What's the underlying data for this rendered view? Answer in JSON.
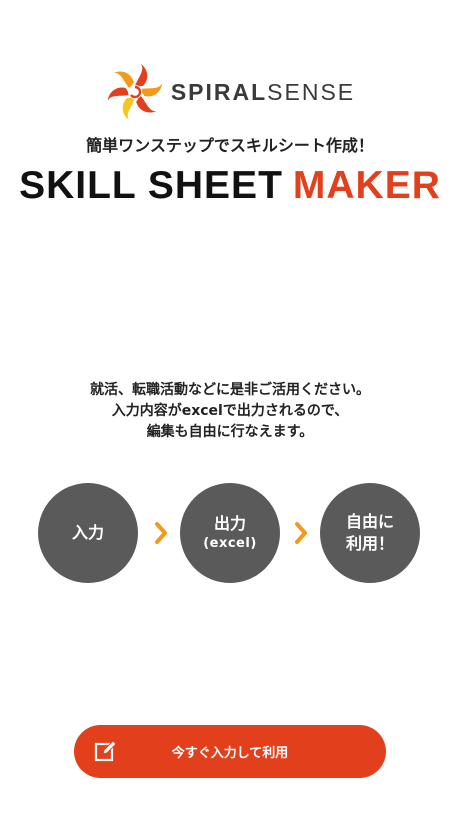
{
  "brand": {
    "name_bold": "SPIRAL",
    "name_light": "SENSE",
    "logo_icon": "spiral-flame-logo",
    "colors": {
      "red": "#e2401c",
      "orange": "#f39a1a",
      "yellow": "#f7c51e"
    }
  },
  "header": {
    "tagline": "簡単ワンステップでスキルシート作成！",
    "title_dark": "SKILL SHEET",
    "title_accent": "MAKER"
  },
  "description": {
    "lines": [
      "就活、転職活動などに是非ご活用ください。",
      "入力内容がexcelで出力されるので、",
      "編集も自由に行なえます。"
    ]
  },
  "steps": [
    {
      "line1": "入力",
      "line2": ""
    },
    {
      "line1": "出力",
      "line2": "(excel)"
    },
    {
      "line1": "自由に",
      "line2": "利用！"
    }
  ],
  "step_arrow_icon": "chevron-right-icon",
  "step_arrow_color": "#f39a1a",
  "step_circle_color": "#5a5a5a",
  "cta": {
    "label": "今すぐ入力して利用",
    "icon": "edit-icon",
    "color": "#e2401c"
  }
}
